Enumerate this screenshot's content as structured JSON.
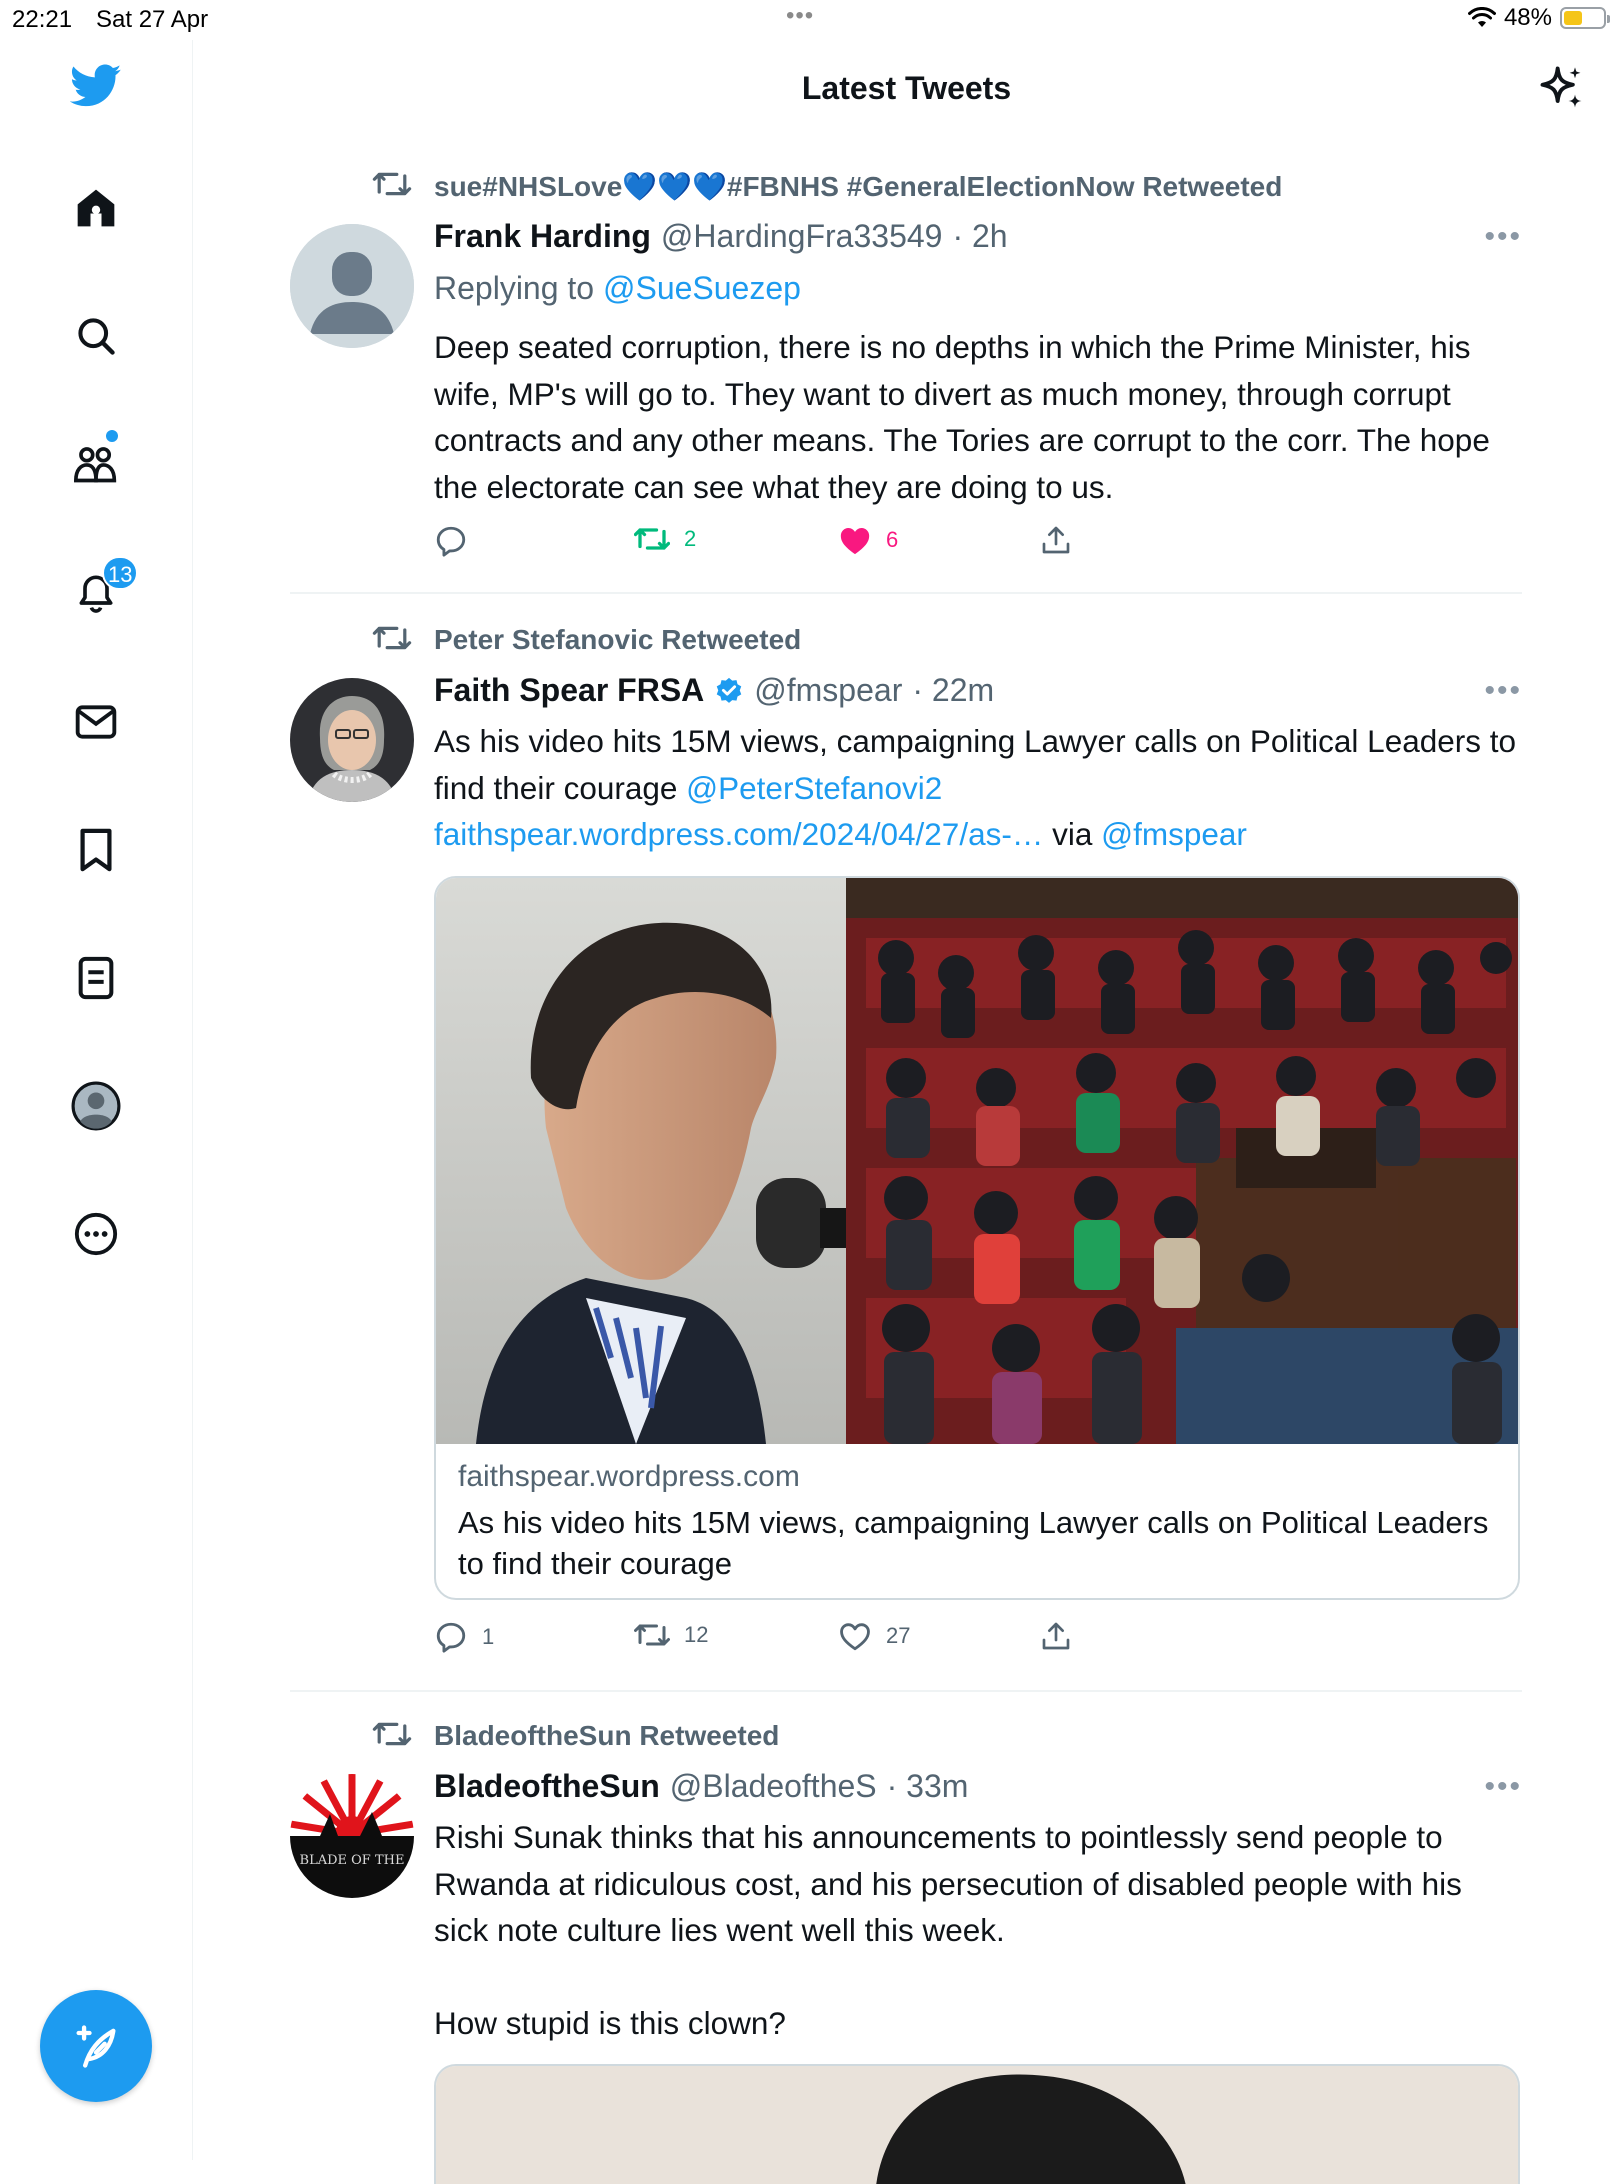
{
  "status_bar": {
    "time": "22:21",
    "date": "Sat 27 Apr",
    "multitask": "•••",
    "battery": "48%"
  },
  "header": {
    "title": "Latest Tweets"
  },
  "sidebar": {
    "notifications_badge": "13",
    "icons": [
      "twitter-logo-icon",
      "home-icon",
      "search-icon",
      "communities-icon",
      "notifications-icon",
      "messages-icon",
      "bookmarks-icon",
      "lists-icon",
      "profile-icon",
      "more-icon"
    ]
  },
  "tweets": [
    {
      "retweeted_by": "sue#NHSLove💙💙💙#FBNHS #GeneralElectionNow Retweeted",
      "name": "Frank Harding",
      "handle": "@HardingFra33549",
      "time": "· 2h",
      "replying_prefix": "Replying to",
      "replying_to": "@SueSuezep",
      "text": "Deep seated corruption, there is no depths in which the Prime Minister, his wife, MP's will go to. They want to divert as much money, through corrupt contracts and any other means. The Tories are corrupt to the corr. The hope the electorate can see what they are doing to us.",
      "replies": "",
      "retweets": "2",
      "likes": "6",
      "liked": true,
      "retweeted": true
    },
    {
      "retweeted_by": "Peter Stefanovic Retweeted",
      "name": "Faith Spear FRSA",
      "handle": "@fmspear",
      "time": "· 22m",
      "text_part1": "As his video hits 15M views, campaigning Lawyer calls on Political Leaders to find their courage",
      "mention1": "@PeterStefanovi2",
      "url": "faithspear.wordpress.com/2024/04/27/as-…",
      "via": "via",
      "mention2": "@fmspear",
      "card": {
        "domain": "faithspear.wordpress.com",
        "title": "As his video hits 15M views, campaigning Lawyer calls on Political Leaders to find their courage"
      },
      "replies": "1",
      "retweets": "12",
      "likes": "27"
    },
    {
      "retweeted_by": "BladeoftheSun Retweeted",
      "name": "BladeoftheSun",
      "handle": "@BladeoftheS",
      "time": "· 33m",
      "text": "Rishi Sunak thinks that his announcements to pointlessly send people to Rwanda at ridiculous cost, and his persecution of disabled people with his sick note culture lies went well this week.",
      "text2": "How stupid is this clown?",
      "avatar_text": "BLADE OF THE"
    }
  ],
  "colors": {
    "accent": "#1d9bf0",
    "retweet": "#00ba7c",
    "like": "#f91880",
    "secondary": "#536471"
  }
}
